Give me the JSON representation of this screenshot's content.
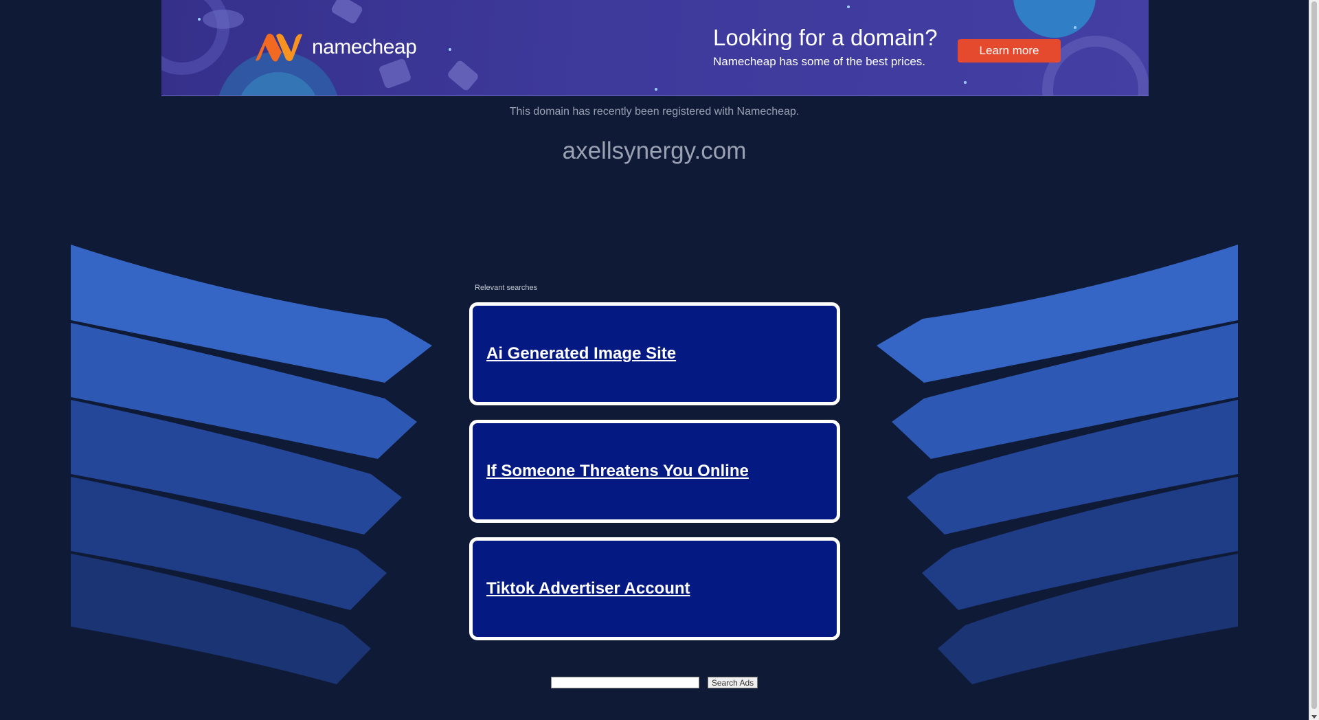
{
  "banner": {
    "logo_text": "namecheap",
    "headline": "Looking for a domain?",
    "subline": "Namecheap has some of the best prices.",
    "learn_more": "Learn more",
    "accent_color": "#e64a2e"
  },
  "registered_text": "This domain has recently been registered with Namecheap.",
  "domain_name": "axellsynergy.com",
  "relevant_label": "Relevant searches",
  "ads": [
    {
      "label": "Ai Generated Image Site"
    },
    {
      "label": "If Someone Threatens You Online"
    },
    {
      "label": "Tiktok Advertiser Account"
    }
  ],
  "search": {
    "input_value": "",
    "button_label": "Search Ads"
  },
  "colors": {
    "background": "#0f1a36",
    "ad_box": "#041a82",
    "wing_light": "#3a6bd0",
    "wing_dark": "#1e3a8a"
  }
}
